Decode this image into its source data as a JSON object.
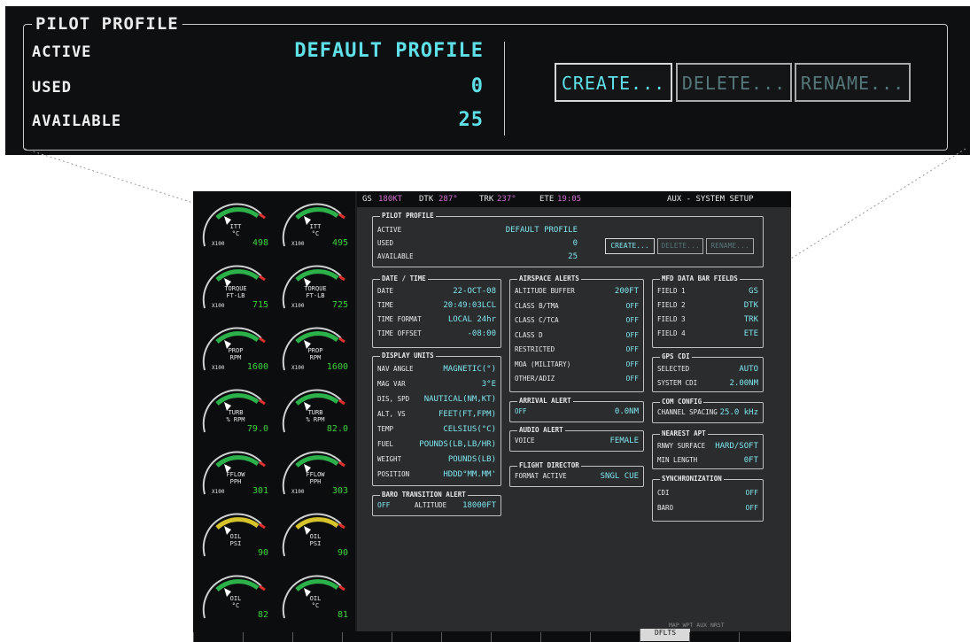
{
  "callout": {
    "title": "PILOT PROFILE",
    "rows": [
      {
        "label": "ACTIVE",
        "value": "DEFAULT PROFILE"
      },
      {
        "label": "USED",
        "value": "0"
      },
      {
        "label": "AVAILABLE",
        "value": "25"
      }
    ],
    "buttons": [
      {
        "label": "CREATE...",
        "enabled": true
      },
      {
        "label": "DELETE...",
        "enabled": false
      },
      {
        "label": "RENAME...",
        "enabled": false
      }
    ]
  },
  "topbar": {
    "gs_label": "GS",
    "gs_value": "180KT",
    "dtk_label": "DTK",
    "dtk_value": "287°",
    "trk_label": "TRK",
    "trk_value": "237°",
    "ete_label": "ETE",
    "ete_value": "19:05",
    "page_title": "AUX - SYSTEM SETUP"
  },
  "eis": {
    "gauges": [
      {
        "name": "ITT",
        "unit": "°C",
        "scale": "X100",
        "value": "498"
      },
      {
        "name": "ITT",
        "unit": "°C",
        "scale": "X100",
        "value": "495"
      },
      {
        "name": "TORQUE",
        "unit": "FT-LB",
        "scale": "X100",
        "value": "715"
      },
      {
        "name": "TORQUE",
        "unit": "FT-LB",
        "scale": "X100",
        "value": "725"
      },
      {
        "name": "PROP",
        "unit": "RPM",
        "scale": "X100",
        "value": "1600"
      },
      {
        "name": "PROP",
        "unit": "RPM",
        "scale": "X100",
        "value": "1600"
      },
      {
        "name": "TURB",
        "unit": "% RPM",
        "scale": "",
        "value": "79.0"
      },
      {
        "name": "TURB",
        "unit": "% RPM",
        "scale": "",
        "value": "82.0"
      },
      {
        "name": "FFLOW",
        "unit": "PPH",
        "scale": "X100",
        "value": "301"
      },
      {
        "name": "FFLOW",
        "unit": "PPH",
        "scale": "X100",
        "value": "303"
      },
      {
        "name": "OIL",
        "unit": "PSI",
        "scale": "",
        "value": "90"
      },
      {
        "name": "OIL",
        "unit": "PSI",
        "scale": "",
        "value": "90"
      },
      {
        "name": "OIL",
        "unit": "°C",
        "scale": "",
        "value": "82"
      },
      {
        "name": "OIL",
        "unit": "°C",
        "scale": "",
        "value": "81"
      }
    ]
  },
  "pilot_profile": {
    "title": "PILOT PROFILE",
    "active_label": "ACTIVE",
    "active_value": "DEFAULT PROFILE",
    "used_label": "USED",
    "used_value": "0",
    "available_label": "AVAILABLE",
    "available_value": "25",
    "create": "CREATE...",
    "delete": "DELETE...",
    "rename": "RENAME..."
  },
  "date_time": {
    "title": "DATE / TIME",
    "rows": [
      {
        "k": "DATE",
        "v": "22-OCT-08"
      },
      {
        "k": "TIME",
        "v": "20:49:03LCL"
      },
      {
        "k": "TIME FORMAT",
        "v": "LOCAL 24hr"
      },
      {
        "k": "TIME OFFSET",
        "v": "-08:00"
      }
    ]
  },
  "display_units": {
    "title": "DISPLAY UNITS",
    "rows": [
      {
        "k": "NAV ANGLE",
        "v": "MAGNETIC(°)"
      },
      {
        "k": "MAG VAR",
        "v": "3°E"
      },
      {
        "k": "DIS, SPD",
        "v": "NAUTICAL(NM,KT)"
      },
      {
        "k": "ALT, VS",
        "v": "FEET(FT,FPM)"
      },
      {
        "k": "TEMP",
        "v": "CELSIUS(°C)"
      },
      {
        "k": "FUEL",
        "v": "POUNDS(LB,LB/HR)"
      },
      {
        "k": "WEIGHT",
        "v": "POUNDS(LB)"
      },
      {
        "k": "POSITION",
        "v": "HDDD°MM.MM'"
      }
    ]
  },
  "baro_alert": {
    "title": "BARO TRANSITION ALERT",
    "state": "OFF",
    "alt_label": "ALTITUDE",
    "alt_value": "18000FT"
  },
  "airspace_alerts": {
    "title": "AIRSPACE ALERTS",
    "rows": [
      {
        "k": "ALTITUDE BUFFER",
        "v": "200FT"
      },
      {
        "k": "CLASS B/TMA",
        "v": "OFF"
      },
      {
        "k": "CLASS C/TCA",
        "v": "OFF"
      },
      {
        "k": "CLASS D",
        "v": "OFF"
      },
      {
        "k": "RESTRICTED",
        "v": "OFF"
      },
      {
        "k": "MOA (MILITARY)",
        "v": "OFF"
      },
      {
        "k": "OTHER/ADIZ",
        "v": "OFF"
      }
    ]
  },
  "arrival_alert": {
    "title": "ARRIVAL ALERT",
    "state": "OFF",
    "dist": "0.0NM"
  },
  "audio_alert": {
    "title": "AUDIO ALERT",
    "k": "VOICE",
    "v": "FEMALE"
  },
  "flight_director": {
    "title": "FLIGHT DIRECTOR",
    "k": "FORMAT ACTIVE",
    "v": "SNGL CUE"
  },
  "mfd_fields": {
    "title": "MFD DATA BAR FIELDS",
    "rows": [
      {
        "k": "FIELD 1",
        "v": "GS"
      },
      {
        "k": "FIELD 2",
        "v": "DTK"
      },
      {
        "k": "FIELD 3",
        "v": "TRK"
      },
      {
        "k": "FIELD 4",
        "v": "ETE"
      }
    ]
  },
  "gps_cdi": {
    "title": "GPS CDI",
    "rows": [
      {
        "k": "SELECTED",
        "v": "AUTO"
      },
      {
        "k": "SYSTEM CDI",
        "v": "2.00NM"
      }
    ]
  },
  "com_config": {
    "title": "COM CONFIG",
    "k": "CHANNEL SPACING",
    "v": "25.0 kHz"
  },
  "nearest_apt": {
    "title": "NEAREST APT",
    "rows": [
      {
        "k": "RNWY SURFACE",
        "v": "HARD/SOFT"
      },
      {
        "k": "MIN LENGTH",
        "v": "0FT"
      }
    ]
  },
  "synchronization": {
    "title": "SYNCHRONIZATION",
    "rows": [
      {
        "k": "CDI",
        "v": "OFF"
      },
      {
        "k": "BARO",
        "v": "OFF"
      }
    ]
  },
  "page_group": {
    "label": "MAP WPT AUX NRST"
  },
  "softkeys": {
    "defaults": "DFLTS"
  }
}
